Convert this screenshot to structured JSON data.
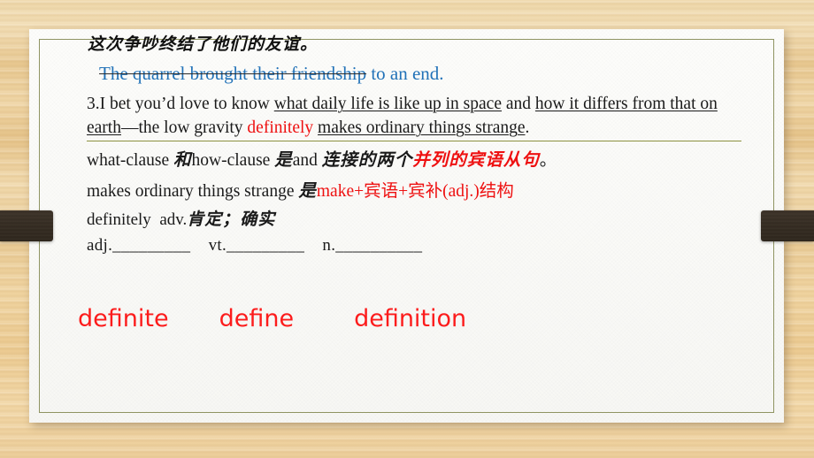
{
  "slide": {
    "background_style": "wood-grain",
    "colors": {
      "wood_light": "#f2ddb4",
      "wood_mid": "#e8c890",
      "panel_bg": "#fdfdfb",
      "inner_border": "#8f9462",
      "dark_bar": "#352c22",
      "blue_text": "#2272b8",
      "red_text": "#ee1111",
      "olive_rule": "#8c9140"
    }
  },
  "content": {
    "chinese_translation_line": "这次争吵终结了他们的友谊。",
    "english_answer": {
      "struck_part": "The quarrel brought their friendship",
      "rest": " to an end."
    },
    "question_3": {
      "prefix": "3.I bet you’d love to know ",
      "clause_1": "what daily life is like up in space",
      "conj": " and ",
      "clause_2_start": "how it differs from that on",
      "clause_2_end": "earth",
      "middle": "—the low gravity ",
      "red_word": "definitely",
      "clause_3": "makes ordinary things strange",
      "period": "."
    },
    "note_1": {
      "black_a": "what-clause ",
      "cn_a": "和",
      "black_b": "how-clause ",
      "cn_b": "是",
      "black_c": "and ",
      "cn_c": "连接的两个",
      "red_cn": "并列的宾语从句",
      "cn_end": "。"
    },
    "note_2": {
      "black": "makes ordinary things strange ",
      "cn": "是",
      "red": "make+宾语+宾补(adj.)结构"
    },
    "note_3": {
      "word": "definitely",
      "pos": "adv.",
      "cn_meaning": "肯定；确实"
    },
    "blanks_line": {
      "adj": "adj._________",
      "vt": "vt._________",
      "n": "n.__________"
    },
    "vocab_answers": [
      "definite",
      "define",
      "definition"
    ]
  }
}
